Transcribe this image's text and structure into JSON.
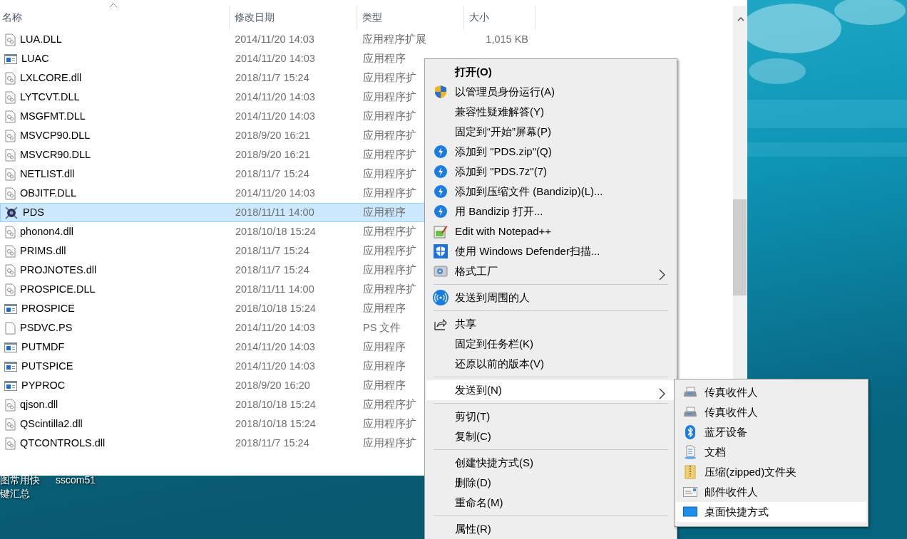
{
  "files": {
    "columns": [
      {
        "label": "名称",
        "sorted": true
      },
      {
        "label": "修改日期",
        "sorted": false
      },
      {
        "label": "类型",
        "sorted": false
      },
      {
        "label": "大小",
        "sorted": false
      }
    ],
    "rows": [
      {
        "kind": "dll",
        "name": "LUA.DLL",
        "date": "2014/11/20 14:03",
        "type": "应用程序扩展",
        "size": "1,015 KB",
        "selected": false
      },
      {
        "kind": "exe",
        "name": "LUAC",
        "date": "2014/11/20 14:03",
        "type": "应用程序",
        "selected": false
      },
      {
        "kind": "dll",
        "name": "LXLCORE.dll",
        "date": "2018/11/7 15:24",
        "type": "应用程序扩",
        "selected": false
      },
      {
        "kind": "dll",
        "name": "LYTCVT.DLL",
        "date": "2014/11/20 14:03",
        "type": "应用程序扩",
        "selected": false
      },
      {
        "kind": "dll",
        "name": "MSGFMT.DLL",
        "date": "2014/11/20 14:03",
        "type": "应用程序扩",
        "selected": false
      },
      {
        "kind": "dll",
        "name": "MSVCP90.DLL",
        "date": "2018/9/20 16:21",
        "type": "应用程序扩",
        "selected": false
      },
      {
        "kind": "dll",
        "name": "MSVCR90.DLL",
        "date": "2018/9/20 16:21",
        "type": "应用程序扩",
        "selected": false
      },
      {
        "kind": "dll",
        "name": "NETLIST.dll",
        "date": "2018/11/7 15:24",
        "type": "应用程序扩",
        "selected": false
      },
      {
        "kind": "dll",
        "name": "OBJITF.DLL",
        "date": "2014/11/20 14:03",
        "type": "应用程序扩",
        "selected": false
      },
      {
        "kind": "app",
        "name": "PDS",
        "date": "2018/11/11 14:00",
        "type": "应用程序",
        "selected": true
      },
      {
        "kind": "dll",
        "name": "phonon4.dll",
        "date": "2018/10/18 15:24",
        "type": "应用程序扩",
        "selected": false
      },
      {
        "kind": "dll",
        "name": "PRIMS.dll",
        "date": "2018/11/7 15:24",
        "type": "应用程序扩",
        "selected": false
      },
      {
        "kind": "dll",
        "name": "PROJNOTES.dll",
        "date": "2018/11/7 15:24",
        "type": "应用程序扩",
        "selected": false
      },
      {
        "kind": "dll",
        "name": "PROSPICE.DLL",
        "date": "2018/11/11 14:00",
        "type": "应用程序扩",
        "selected": false
      },
      {
        "kind": "exe",
        "name": "PROSPICE",
        "date": "2018/10/18 15:24",
        "type": "应用程序",
        "selected": false
      },
      {
        "kind": "file",
        "name": "PSDVC.PS",
        "date": "2014/11/20 14:03",
        "type": "PS 文件",
        "selected": false
      },
      {
        "kind": "exe",
        "name": "PUTMDF",
        "date": "2014/11/20 14:03",
        "type": "应用程序",
        "selected": false
      },
      {
        "kind": "exe",
        "name": "PUTSPICE",
        "date": "2014/11/20 14:03",
        "type": "应用程序",
        "selected": false
      },
      {
        "kind": "exe",
        "name": "PYPROC",
        "date": "2018/9/20 16:20",
        "type": "应用程序",
        "selected": false
      },
      {
        "kind": "dll",
        "name": "qjson.dll",
        "date": "2018/10/18 15:24",
        "type": "应用程序扩",
        "selected": false
      },
      {
        "kind": "dll",
        "name": "QScintilla2.dll",
        "date": "2018/10/18 15:24",
        "type": "应用程序扩",
        "selected": false
      },
      {
        "kind": "dll",
        "name": "QTCONTROLS.dll",
        "date": "2018/11/7 15:24",
        "type": "应用程序扩",
        "selected": false
      }
    ]
  },
  "desktop_icons": [
    {
      "label_lines": [
        "图常用快",
        "键汇总"
      ]
    },
    {
      "label_lines": [
        "sscom51"
      ]
    }
  ],
  "context_menu": {
    "items": [
      {
        "kind": "plain",
        "label": "打开(O)",
        "default": true,
        "submenu": false,
        "selected": false
      },
      {
        "kind": "uac",
        "label": "以管理员身份运行(A)",
        "default": false,
        "submenu": false,
        "selected": false
      },
      {
        "kind": "plain",
        "label": "兼容性疑难解答(Y)",
        "default": false,
        "submenu": false,
        "selected": false
      },
      {
        "kind": "plain",
        "label": "固定到“开始”屏幕(P)",
        "default": false,
        "submenu": false,
        "selected": false
      },
      {
        "kind": "bandizip",
        "label": "添加到 \"PDS.zip\"(Q)",
        "default": false,
        "submenu": false,
        "selected": false
      },
      {
        "kind": "bandizip",
        "label": "添加到 \"PDS.7z\"(7)",
        "default": false,
        "submenu": false,
        "selected": false
      },
      {
        "kind": "bandizip",
        "label": "添加到压缩文件 (Bandizip)(L)...",
        "default": false,
        "submenu": false,
        "selected": false
      },
      {
        "kind": "bandizip",
        "label": "用 Bandizip 打开...",
        "default": false,
        "submenu": false,
        "selected": false
      },
      {
        "kind": "notepad",
        "label": "Edit with Notepad++",
        "default": false,
        "submenu": false,
        "selected": false
      },
      {
        "kind": "defender",
        "label": "使用 Windows Defender扫描...",
        "default": false,
        "submenu": false,
        "selected": false
      },
      {
        "kind": "factory",
        "label": "格式工厂",
        "default": false,
        "submenu": true,
        "selected": false
      },
      {
        "kind": "separator"
      },
      {
        "kind": "nearby",
        "label": "发送到周围的人",
        "default": false,
        "submenu": false,
        "selected": false
      },
      {
        "kind": "separator"
      },
      {
        "kind": "share",
        "label": "共享",
        "default": false,
        "submenu": false,
        "selected": false
      },
      {
        "kind": "plain",
        "label": "固定到任务栏(K)",
        "default": false,
        "submenu": false,
        "selected": false
      },
      {
        "kind": "plain",
        "label": "还原以前的版本(V)",
        "default": false,
        "submenu": false,
        "selected": false
      },
      {
        "kind": "separator"
      },
      {
        "kind": "plain",
        "label": "发送到(N)",
        "default": false,
        "submenu": true,
        "selected": true
      },
      {
        "kind": "separator"
      },
      {
        "kind": "plain",
        "label": "剪切(T)",
        "default": false,
        "submenu": false,
        "selected": false
      },
      {
        "kind": "plain",
        "label": "复制(C)",
        "default": false,
        "submenu": false,
        "selected": false
      },
      {
        "kind": "separator"
      },
      {
        "kind": "plain",
        "label": "创建快捷方式(S)",
        "default": false,
        "submenu": false,
        "selected": false
      },
      {
        "kind": "plain",
        "label": "删除(D)",
        "default": false,
        "submenu": false,
        "selected": false
      },
      {
        "kind": "plain",
        "label": "重命名(M)",
        "default": false,
        "submenu": false,
        "selected": false
      },
      {
        "kind": "separator"
      },
      {
        "kind": "plain",
        "label": "属性(R)",
        "default": false,
        "submenu": false,
        "selected": false
      }
    ]
  },
  "send_to_menu": {
    "items": [
      {
        "kind": "fax",
        "label": "传真收件人",
        "selected": false
      },
      {
        "kind": "fax",
        "label": "传真收件人",
        "selected": false
      },
      {
        "kind": "bluetooth",
        "label": "蓝牙设备",
        "selected": false
      },
      {
        "kind": "document",
        "label": "文档",
        "selected": false
      },
      {
        "kind": "zip",
        "label": "压缩(zipped)文件夹",
        "selected": false
      },
      {
        "kind": "mail",
        "label": "邮件收件人",
        "selected": false
      },
      {
        "kind": "desktop",
        "label": "桌面快捷方式",
        "selected": true
      }
    ]
  }
}
